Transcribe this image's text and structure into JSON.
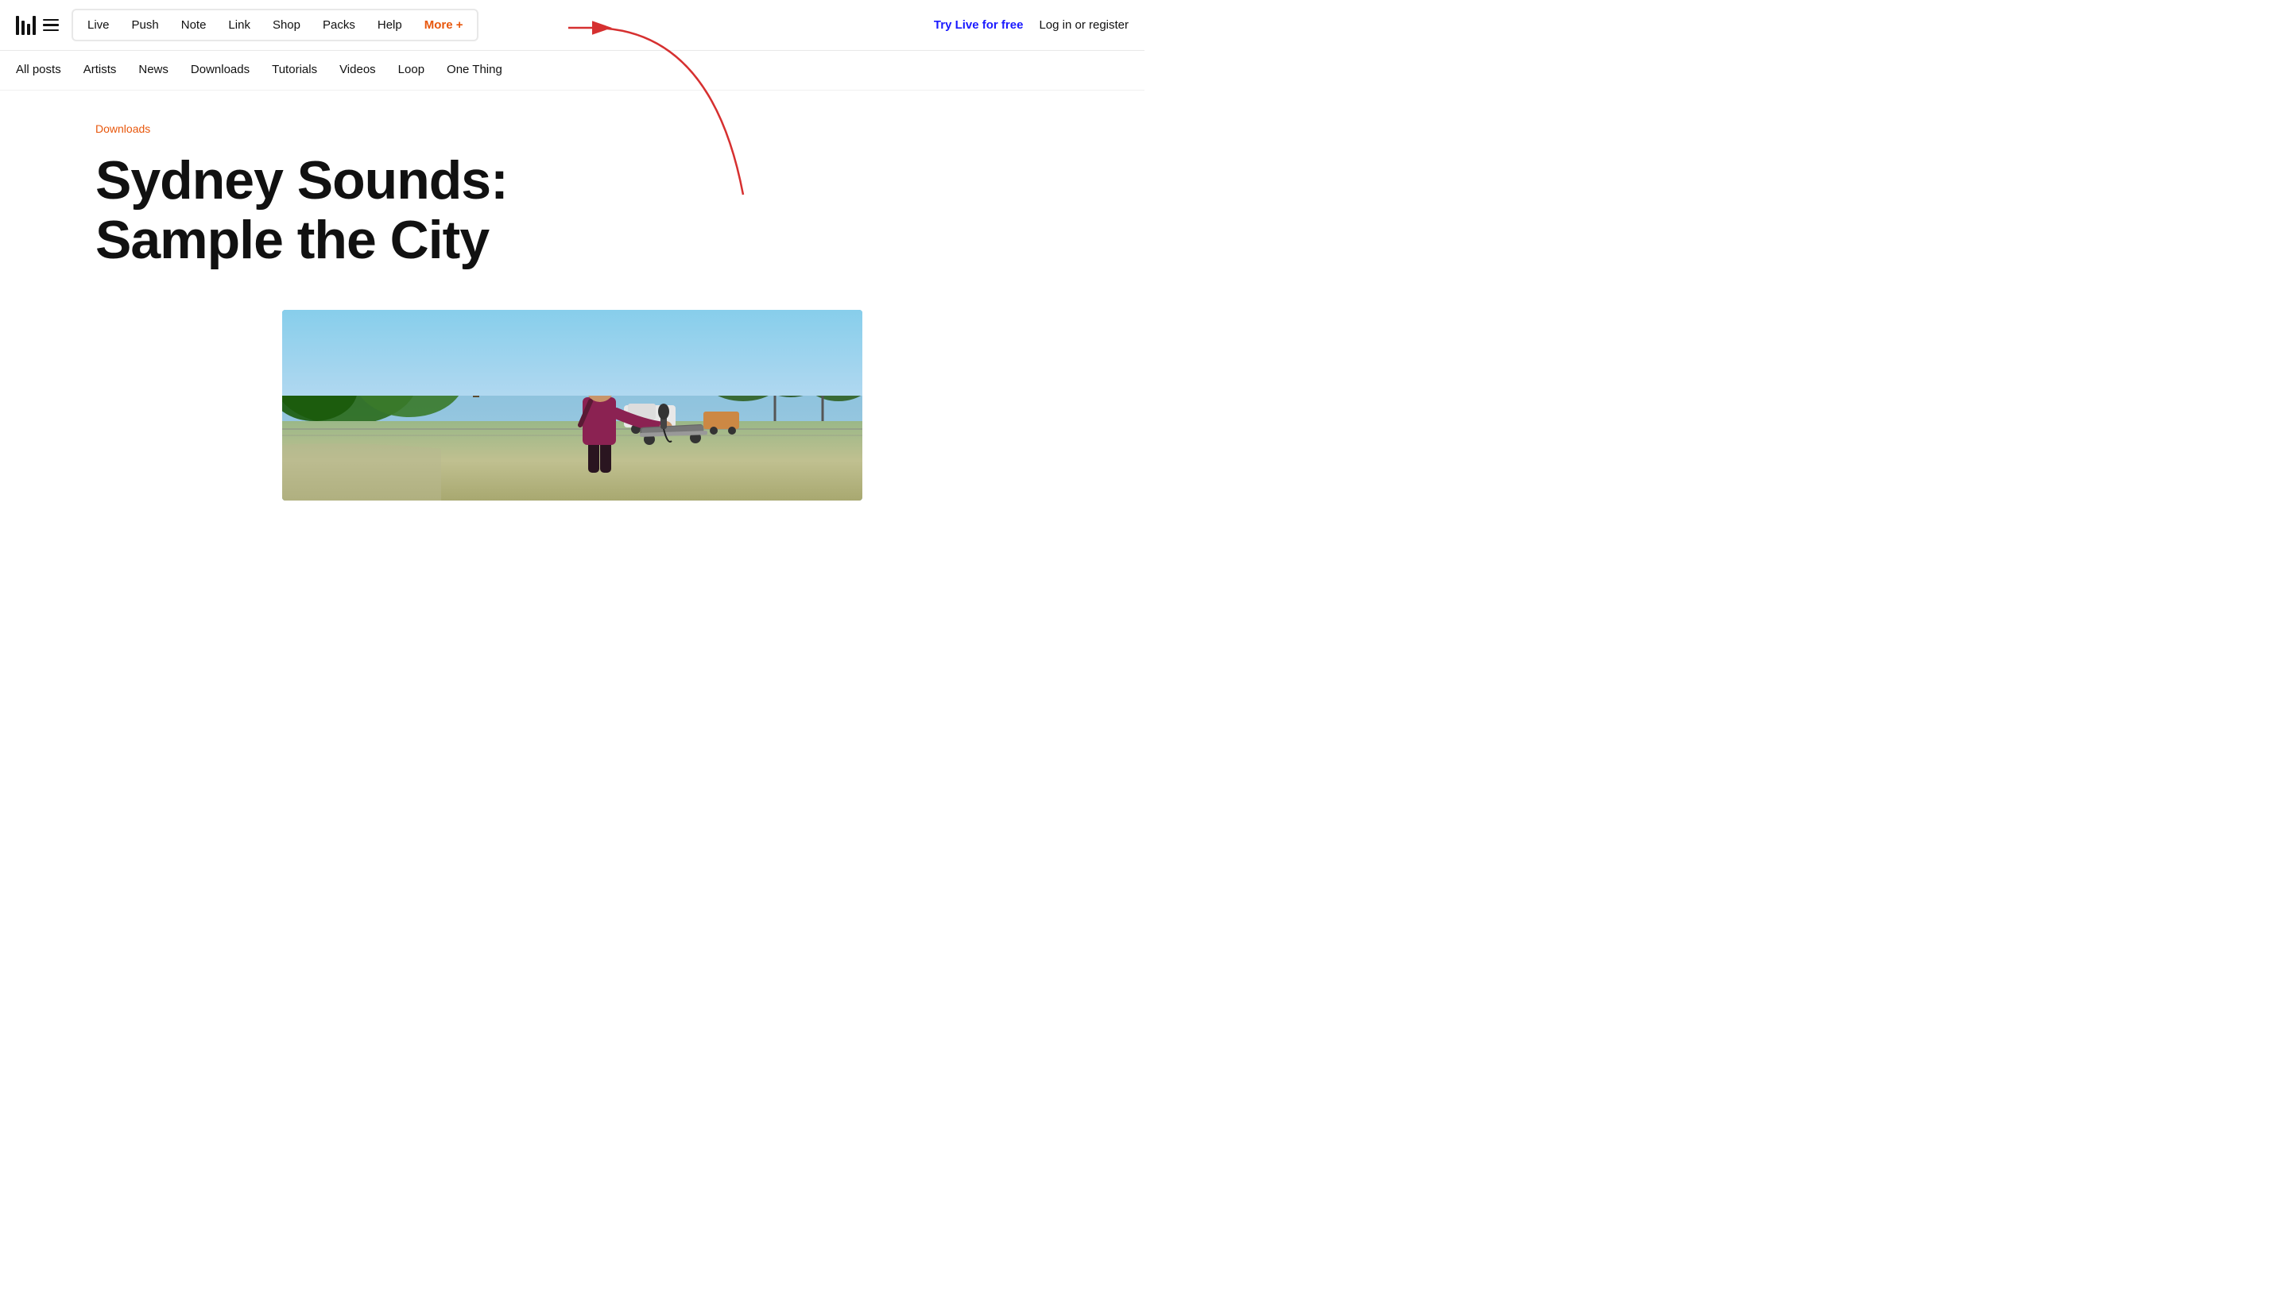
{
  "header": {
    "logo_alt": "Ableton logo"
  },
  "top_nav": {
    "items": [
      {
        "label": "Live",
        "href": "#",
        "active": false
      },
      {
        "label": "Push",
        "href": "#",
        "active": false
      },
      {
        "label": "Note",
        "href": "#",
        "active": false
      },
      {
        "label": "Link",
        "href": "#",
        "active": false
      },
      {
        "label": "Shop",
        "href": "#",
        "active": false
      },
      {
        "label": "Packs",
        "href": "#",
        "active": false
      },
      {
        "label": "Help",
        "href": "#",
        "active": false
      },
      {
        "label": "More +",
        "href": "#",
        "active": true,
        "class": "more"
      }
    ],
    "cta_label": "Try Live for free",
    "login_label": "Log in or register"
  },
  "sub_nav": {
    "items": [
      {
        "label": "All posts",
        "href": "#"
      },
      {
        "label": "Artists",
        "href": "#"
      },
      {
        "label": "News",
        "href": "#"
      },
      {
        "label": "Downloads",
        "href": "#"
      },
      {
        "label": "Tutorials",
        "href": "#"
      },
      {
        "label": "Videos",
        "href": "#"
      },
      {
        "label": "Loop",
        "href": "#"
      },
      {
        "label": "One Thing",
        "href": "#"
      }
    ]
  },
  "article": {
    "category": "Downloads",
    "title": "Sydney Sounds: Sample the City",
    "image_alt": "Person at skatepark with headphones sampling sounds"
  }
}
